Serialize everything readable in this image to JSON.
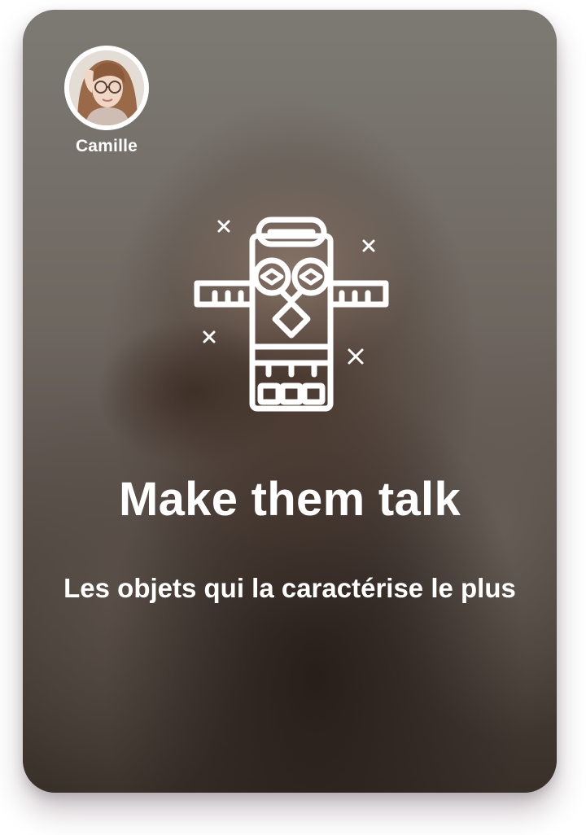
{
  "player": {
    "name": "Camille",
    "avatar_icon": "profile-photo"
  },
  "card": {
    "icon": "totem-icon",
    "title": "Make them talk",
    "subtitle": "Les objets qui la caractérise le plus"
  },
  "colors": {
    "text": "#ffffff",
    "card_background": "#6b6660"
  }
}
